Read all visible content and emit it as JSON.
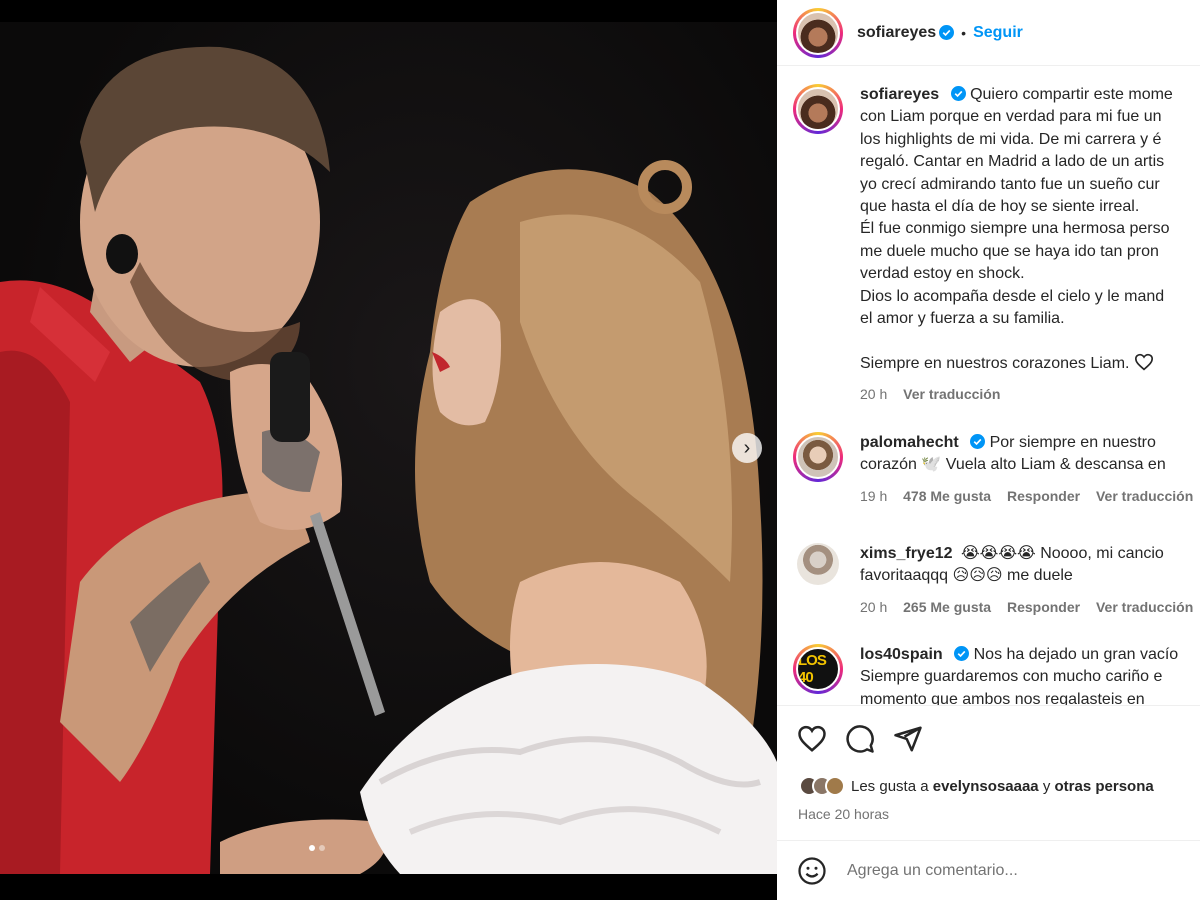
{
  "post": {
    "username": "sofiareyes",
    "separator": "•",
    "follow_label": "Seguir",
    "slide_count": 2,
    "active_slide": 1
  },
  "caption": {
    "username": "sofiareyes",
    "lines": [
      "Quiero compartir este mome",
      "con Liam porque en verdad para mi fue un",
      "los highlights de mi vida. De mi carrera y é",
      "regaló. Cantar en Madrid a lado de un artis",
      "yo crecí admirando tanto fue un sueño cur",
      "que hasta el día de hoy se siente irreal.",
      "Él fue conmigo siempre una hermosa perso",
      "me duele mucho que se haya ido tan pron",
      "verdad estoy en shock.",
      "Dios lo acompaña desde el cielo y le mand",
      "el amor y fuerza a su familia.",
      "",
      "Siempre en nuestros corazones Liam."
    ],
    "time": "20 h",
    "translate": "Ver traducción"
  },
  "comments": [
    {
      "username": "palomahecht",
      "verified": true,
      "line1": "Por siempre en nuestro",
      "line2": "corazón 🕊️ Vuela alto Liam & descansa en",
      "time": "19 h",
      "likes": "478 Me gusta",
      "reply": "Responder",
      "translate": "Ver traducción"
    },
    {
      "username": "xims_frye12",
      "verified": false,
      "line1": "😭😭😭😭 Noooo, mi cancio",
      "line2": "favoritaaqqq 😥😥😥 me duele",
      "time": "20 h",
      "likes": "265 Me gusta",
      "reply": "Responder",
      "translate": "Ver traducción"
    },
    {
      "username": "los40spain",
      "verified": true,
      "avatar_text": "LOS 40",
      "line1": "Nos ha dejado un gran vacío",
      "line2": "Siempre guardaremos con mucho cariño e",
      "line3": "momento que ambos nos regalasteis en"
    }
  ],
  "footer": {
    "likes_prefix": "Les gusta a",
    "likes_user": "evelynsosaaaa",
    "likes_mid": "y",
    "likes_others": "otras persona",
    "time": "Hace 20 horas",
    "comment_placeholder": "Agrega un comentario..."
  },
  "icons": {
    "verified": "verified-badge-icon",
    "like": "heart-icon",
    "comment": "comment-bubble-icon",
    "share": "paper-plane-icon",
    "emoji": "smiley-icon",
    "next": "chevron-right-icon"
  },
  "colors": {
    "accent": "#0095f6",
    "muted": "#737373",
    "text": "#262626"
  }
}
